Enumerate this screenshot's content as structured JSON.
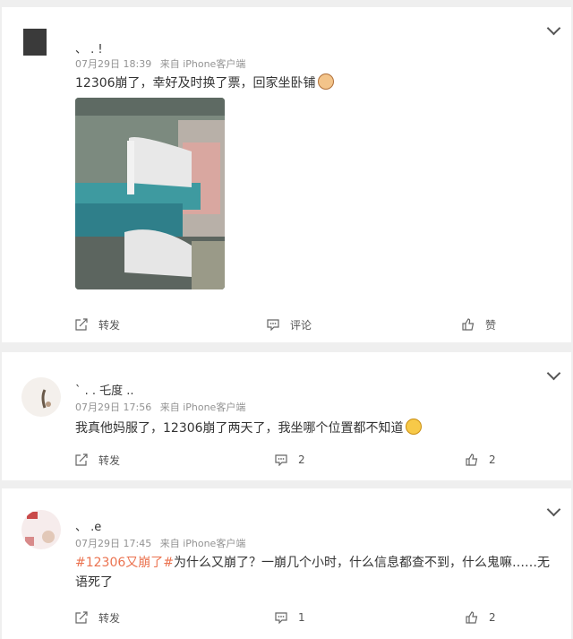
{
  "posts": [
    {
      "username": "、 .  !",
      "date": "07月29日 18:39",
      "source": "来自 iPhone客户端",
      "text": "12306崩了，幸好及时换了票，回家坐卧铺",
      "actions": {
        "repost": "转发",
        "comment": "评论",
        "like": "赞"
      }
    },
    {
      "username": "` .  . 乇度  ..",
      "date": "07月29日 17:56",
      "source": "来自 iPhone客户端",
      "text": "我真他妈服了，12306崩了两天了，我坐哪个位置都不知道",
      "actions": {
        "repost": "转发",
        "comment": "2",
        "like": "2"
      }
    },
    {
      "username": "、 .e",
      "date": "07月29日 17:45",
      "source": "来自 iPhone客户端",
      "tag": "#12306又崩了#",
      "text": "为什么又崩了？一崩几个小时，什么信息都查不到，什么鬼嘛……无语死了",
      "actions": {
        "repost": "转发",
        "comment": "1",
        "like": "2"
      }
    }
  ],
  "colors": {
    "tag": "#eb7350",
    "meta": "#939393",
    "background": "#efefef"
  }
}
